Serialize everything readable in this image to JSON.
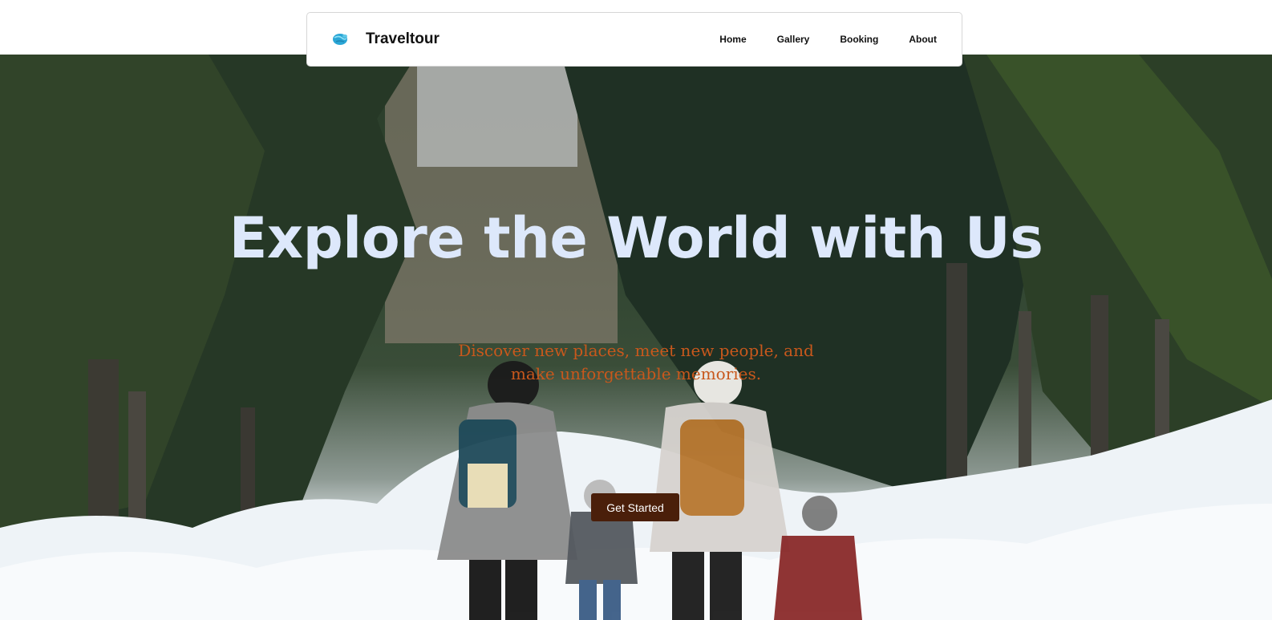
{
  "brand": {
    "name": "Traveltour",
    "logo_icon": "globe-icon",
    "logo_colors": [
      "#2aa6d6",
      "#5ec8e8"
    ]
  },
  "nav": {
    "items": [
      {
        "label": "Home"
      },
      {
        "label": "Gallery"
      },
      {
        "label": "Booking"
      },
      {
        "label": "About"
      }
    ]
  },
  "hero": {
    "title": "Explore the World with Us",
    "subtitle": "Discover new places, meet new people, and make unforgettable memories.",
    "cta_label": "Get Started",
    "title_color": "#dde8fb",
    "subtitle_color": "#c8581c",
    "cta_color": "#4a1f0a",
    "background_scene": "family-walking-in-snowy-forest-photo"
  }
}
